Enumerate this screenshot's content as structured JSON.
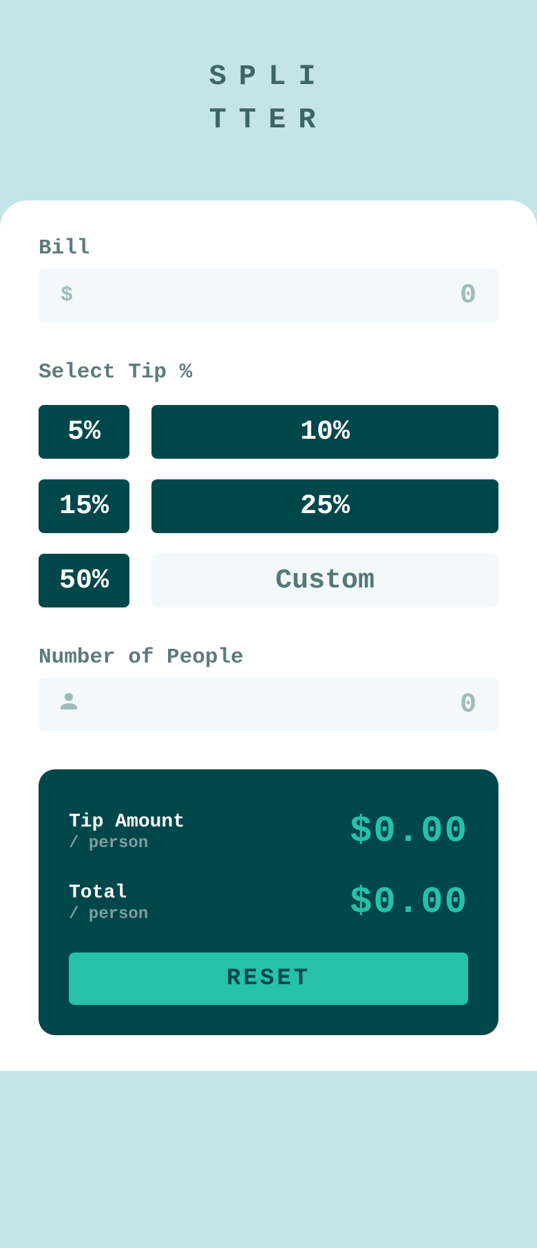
{
  "logo": {
    "line1": "SPLI",
    "line2": "TTER"
  },
  "bill": {
    "label": "Bill",
    "icon": "$",
    "placeholder": "0",
    "value": ""
  },
  "tip": {
    "label": "Select Tip %",
    "options": [
      "5%",
      "10%",
      "15%",
      "25%",
      "50%"
    ],
    "custom_placeholder": "Custom",
    "custom_value": ""
  },
  "people": {
    "label": "Number of People",
    "placeholder": "0",
    "value": ""
  },
  "results": {
    "tip_amount": {
      "label": "Tip Amount",
      "sublabel": "/ person",
      "value": "$0.00"
    },
    "total": {
      "label": "Total",
      "sublabel": "/ person",
      "value": "$0.00"
    },
    "reset_label": "RESET"
  }
}
